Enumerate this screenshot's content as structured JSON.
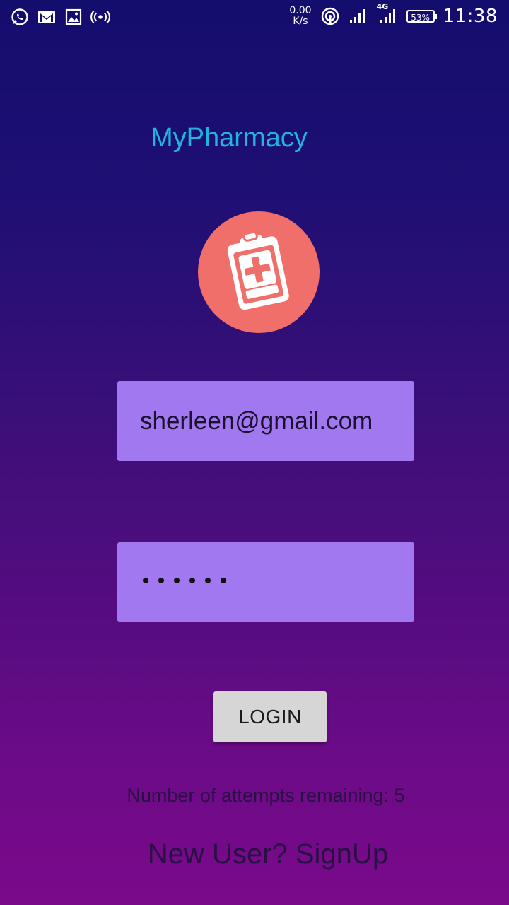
{
  "status_bar": {
    "net_speed_value": "0.00",
    "net_speed_unit": "K/s",
    "network_type": "4G",
    "battery": "53%",
    "time": "11:38",
    "left_icons": [
      "whatsapp-icon",
      "gmail-icon",
      "gallery-icon",
      "hotspot-icon"
    ]
  },
  "app": {
    "title": "MyPharmacy",
    "accent_color": "#1fb6de",
    "logo_color": "#f06f6a"
  },
  "form": {
    "email_value": "sherleen@gmail.com",
    "password_length": 6,
    "field_color": "#a178ef",
    "login_label": "LOGIN",
    "attempts_text": "Number of attempts remaining: 5",
    "signup_text": "New User? SignUp"
  }
}
